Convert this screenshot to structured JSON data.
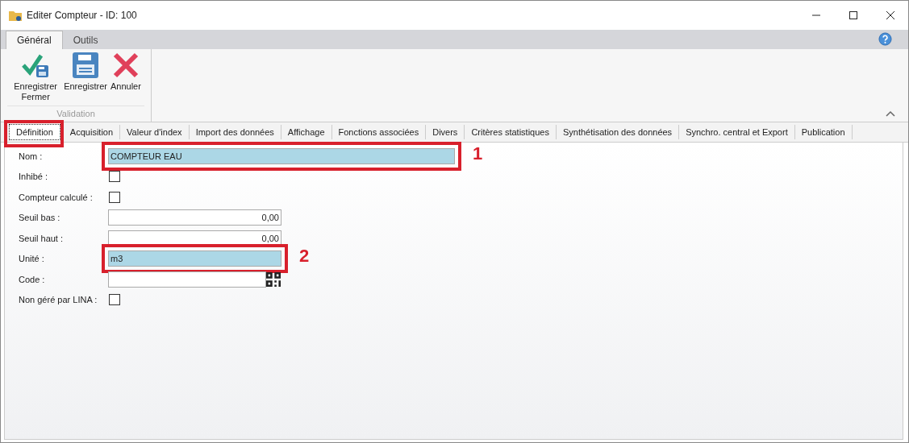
{
  "window": {
    "title": "Editer Compteur - ID: 100"
  },
  "ribbon": {
    "tabs": [
      {
        "label": "Général",
        "selected": true
      },
      {
        "label": "Outils",
        "selected": false
      }
    ],
    "buttons": [
      {
        "kind": "save-close",
        "label": "Enregistrer Fermer"
      },
      {
        "kind": "save",
        "label": "Enregistrer"
      },
      {
        "kind": "cancel",
        "label": "Annuler"
      }
    ],
    "group_label": "Validation"
  },
  "tabs": [
    {
      "label": "Définition",
      "selected": true,
      "annotated": true
    },
    {
      "label": "Acquisition",
      "selected": false,
      "annotated": false
    },
    {
      "label": "Valeur d'index",
      "selected": false,
      "annotated": false
    },
    {
      "label": "Import des données",
      "selected": false,
      "annotated": false
    },
    {
      "label": "Affichage",
      "selected": false,
      "annotated": false
    },
    {
      "label": "Fonctions associées",
      "selected": false,
      "annotated": false
    },
    {
      "label": "Divers",
      "selected": false,
      "annotated": false
    },
    {
      "label": "Critères statistiques",
      "selected": false,
      "annotated": false
    },
    {
      "label": "Synthétisation des données",
      "selected": false,
      "annotated": false
    },
    {
      "label": "Synchro. central et Export",
      "selected": false,
      "annotated": false
    },
    {
      "label": "Publication",
      "selected": false,
      "annotated": false
    }
  ],
  "fields": [
    {
      "kind": "text",
      "label": "Nom :",
      "value": "COMPTEUR EAU",
      "highlighted": true,
      "annotation": "1"
    },
    {
      "kind": "checkbox",
      "label": "Inhibé :",
      "checked": false
    },
    {
      "kind": "checkbox",
      "label": "Compteur calculé :",
      "checked": false
    },
    {
      "kind": "number",
      "label": "Seuil bas :",
      "value": "0,00"
    },
    {
      "kind": "number",
      "label": "Seuil haut :",
      "value": "0,00"
    },
    {
      "kind": "unit",
      "label": "Unité :",
      "value": "m3",
      "highlighted": true,
      "annotation": "2"
    },
    {
      "kind": "code",
      "label": "Code :"
    },
    {
      "kind": "checkbox",
      "label": "Non géré par LINA :",
      "checked": false
    }
  ]
}
